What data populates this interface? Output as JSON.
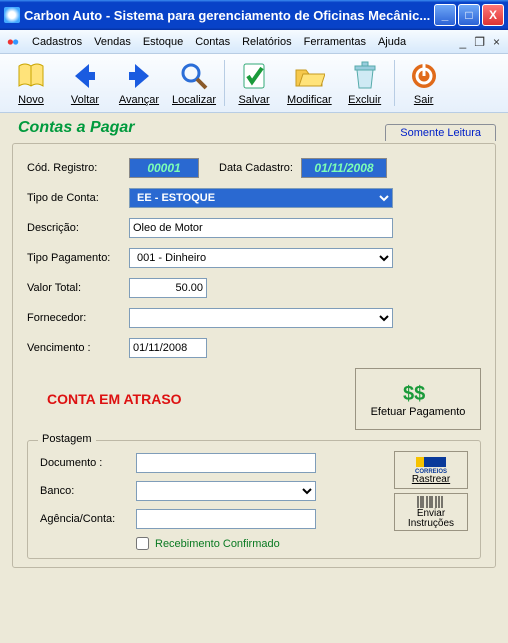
{
  "window": {
    "title": "Carbon Auto - Sistema para gerenciamento de Oficinas Mecânic..."
  },
  "menu": {
    "items": [
      "Cadastros",
      "Vendas",
      "Estoque",
      "Contas",
      "Relatórios",
      "Ferramentas",
      "Ajuda"
    ]
  },
  "toolbar": {
    "novo": "Novo",
    "voltar": "Voltar",
    "avancar": "Avançar",
    "localizar": "Localizar",
    "salvar": "Salvar",
    "modificar": "Modificar",
    "excluir": "Excluir",
    "sair": "Sair"
  },
  "page": {
    "title": "Contas a Pagar",
    "readonly_tab": "Somente Leitura"
  },
  "labels": {
    "cod_registro": "Cód. Registro:",
    "data_cadastro": "Data Cadastro:",
    "tipo_conta": "Tipo de Conta:",
    "descricao": "Descrição:",
    "tipo_pagamento": "Tipo Pagamento:",
    "valor_total": "Valor Total:",
    "fornecedor": "Fornecedor:",
    "vencimento": "Vencimento :"
  },
  "values": {
    "cod_registro": "00001",
    "data_cadastro": "01/11/2008",
    "tipo_conta": "EE - ESTOQUE",
    "descricao": "Oleo de Motor",
    "tipo_pagamento": "001 - Dinheiro",
    "valor_total": "50.00",
    "fornecedor": "",
    "vencimento": "01/11/2008"
  },
  "alert": {
    "text": "CONTA EM ATRASO",
    "pay_button": "Efetuar Pagamento"
  },
  "postagem": {
    "title": "Postagem",
    "documento_label": "Documento :",
    "banco_label": "Banco:",
    "agencia_label": "Agência/Conta:",
    "documento": "",
    "banco": "",
    "agencia": "",
    "correios_label": "CORREIOS",
    "rastrear": "Rastrear",
    "enviar": "Enviar",
    "instrucoes": "Instruções",
    "recebimento_label": "Recebimento Confirmado",
    "recebimento_checked": false
  }
}
